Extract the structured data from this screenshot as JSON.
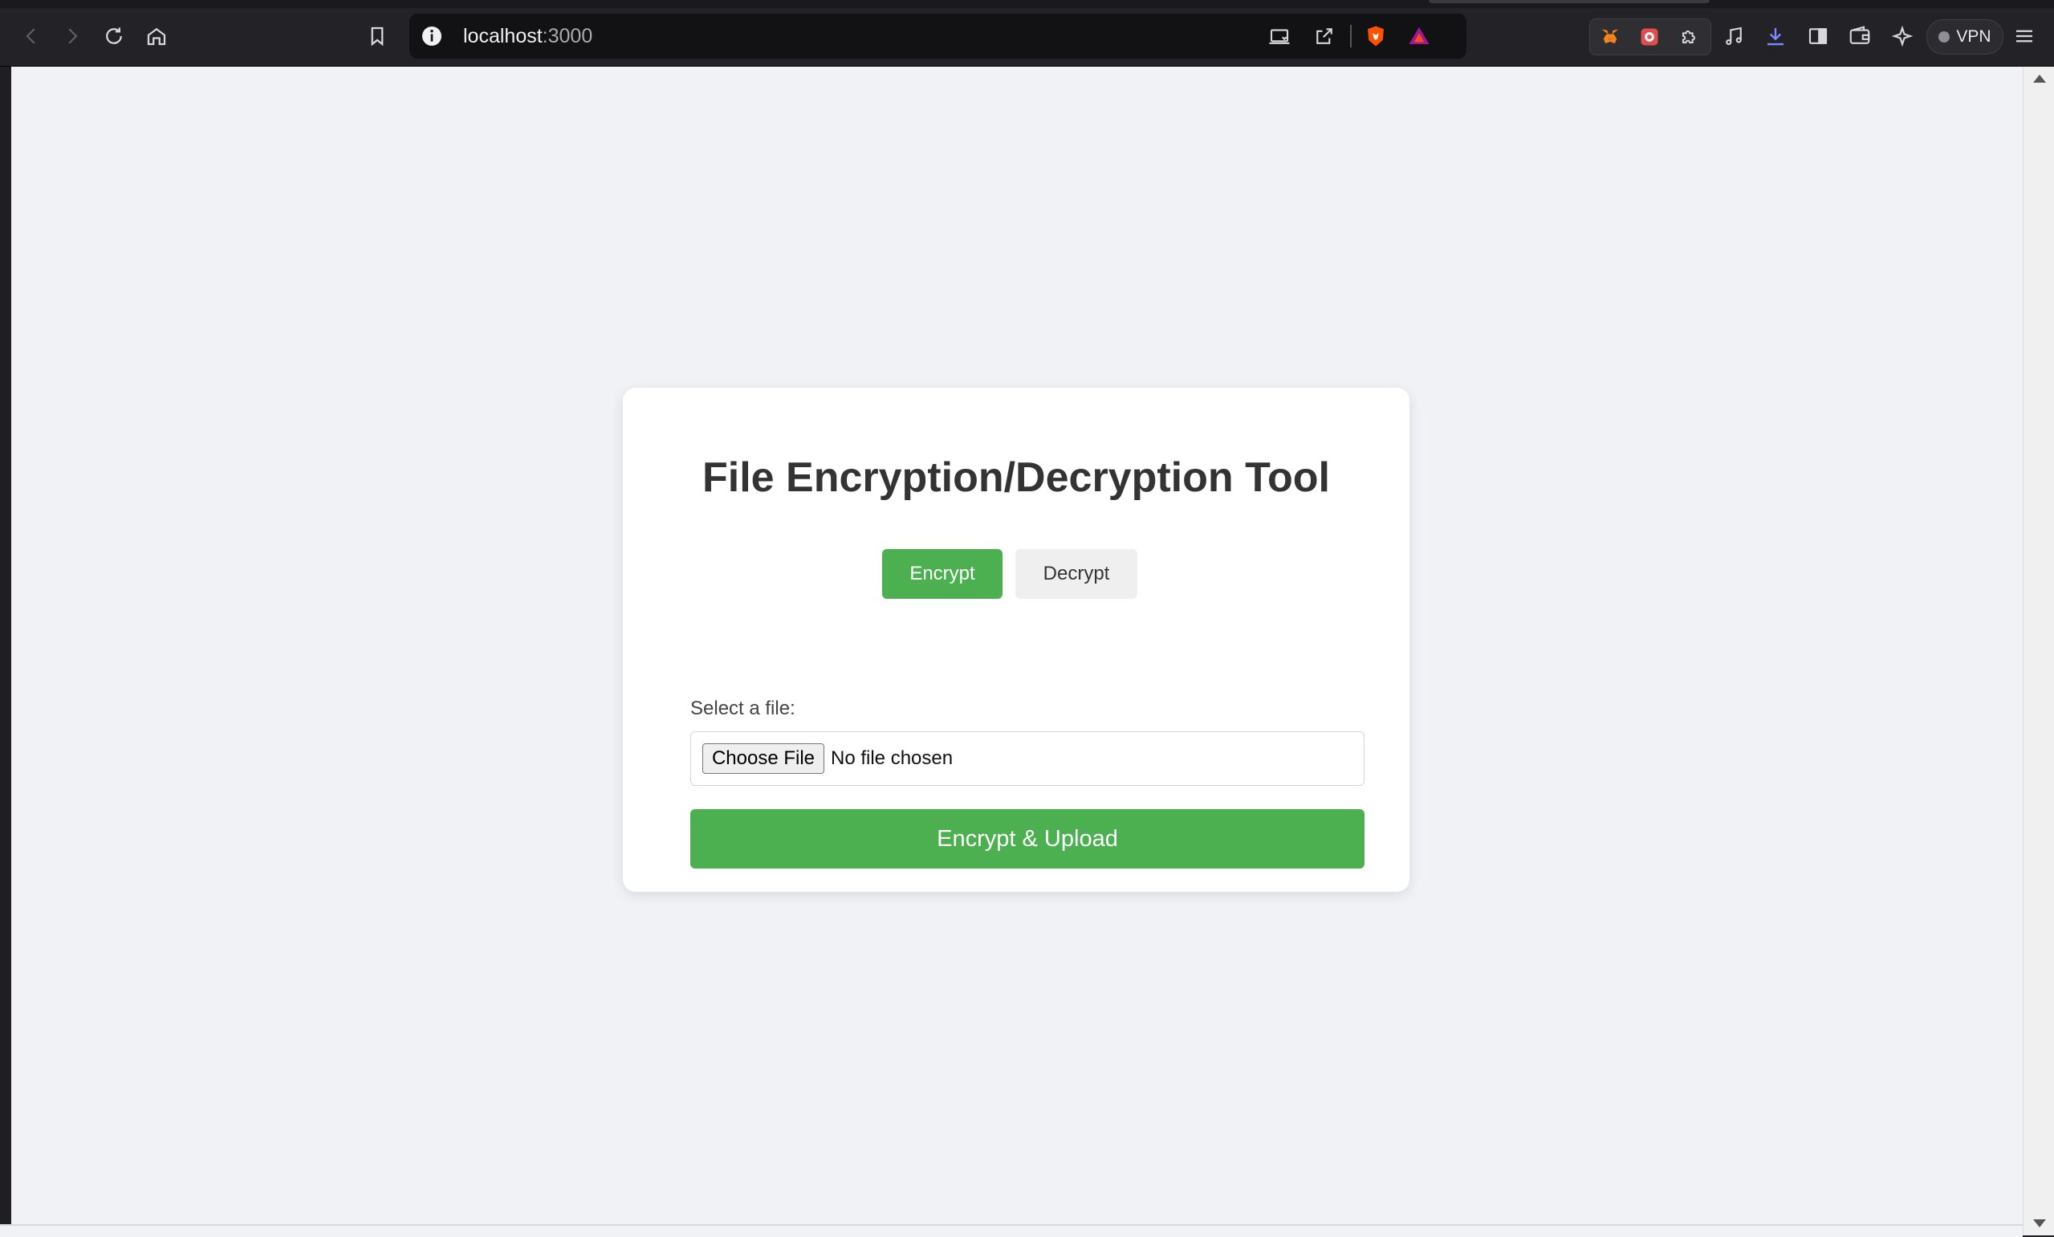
{
  "browser": {
    "url_host": "localhost",
    "url_port": ":3000",
    "vpn_label": "VPN",
    "colors": {
      "toolbar": "#232327",
      "address_bar": "#121214"
    },
    "icons": {
      "nav": [
        "back-icon",
        "forward-icon",
        "reload-icon",
        "home-icon",
        "bookmark-icon"
      ],
      "address_bar": [
        "site-info-icon",
        "cast-icon",
        "share-icon",
        "brave-shields-icon",
        "brave-rewards-icon"
      ],
      "extensions": [
        "metamask-icon",
        "extension-icon",
        "puzzle-icon"
      ],
      "right": [
        "media-icon",
        "download-icon",
        "sidebar-icon",
        "wallet-icon",
        "leo-ai-icon",
        "menu-icon"
      ]
    }
  },
  "page": {
    "background": "#f0f2f5",
    "title": "File Encryption/Decryption Tool",
    "modes": {
      "encrypt_label": "Encrypt",
      "decrypt_label": "Decrypt",
      "active": "Encrypt"
    },
    "file_input": {
      "label": "Select a file:",
      "button_label": "Choose File",
      "status": "No file chosen"
    },
    "submit_label": "Encrypt & Upload",
    "colors": {
      "primary": "#4caf50",
      "secondary": "#efefef",
      "heading": "#333333"
    }
  }
}
